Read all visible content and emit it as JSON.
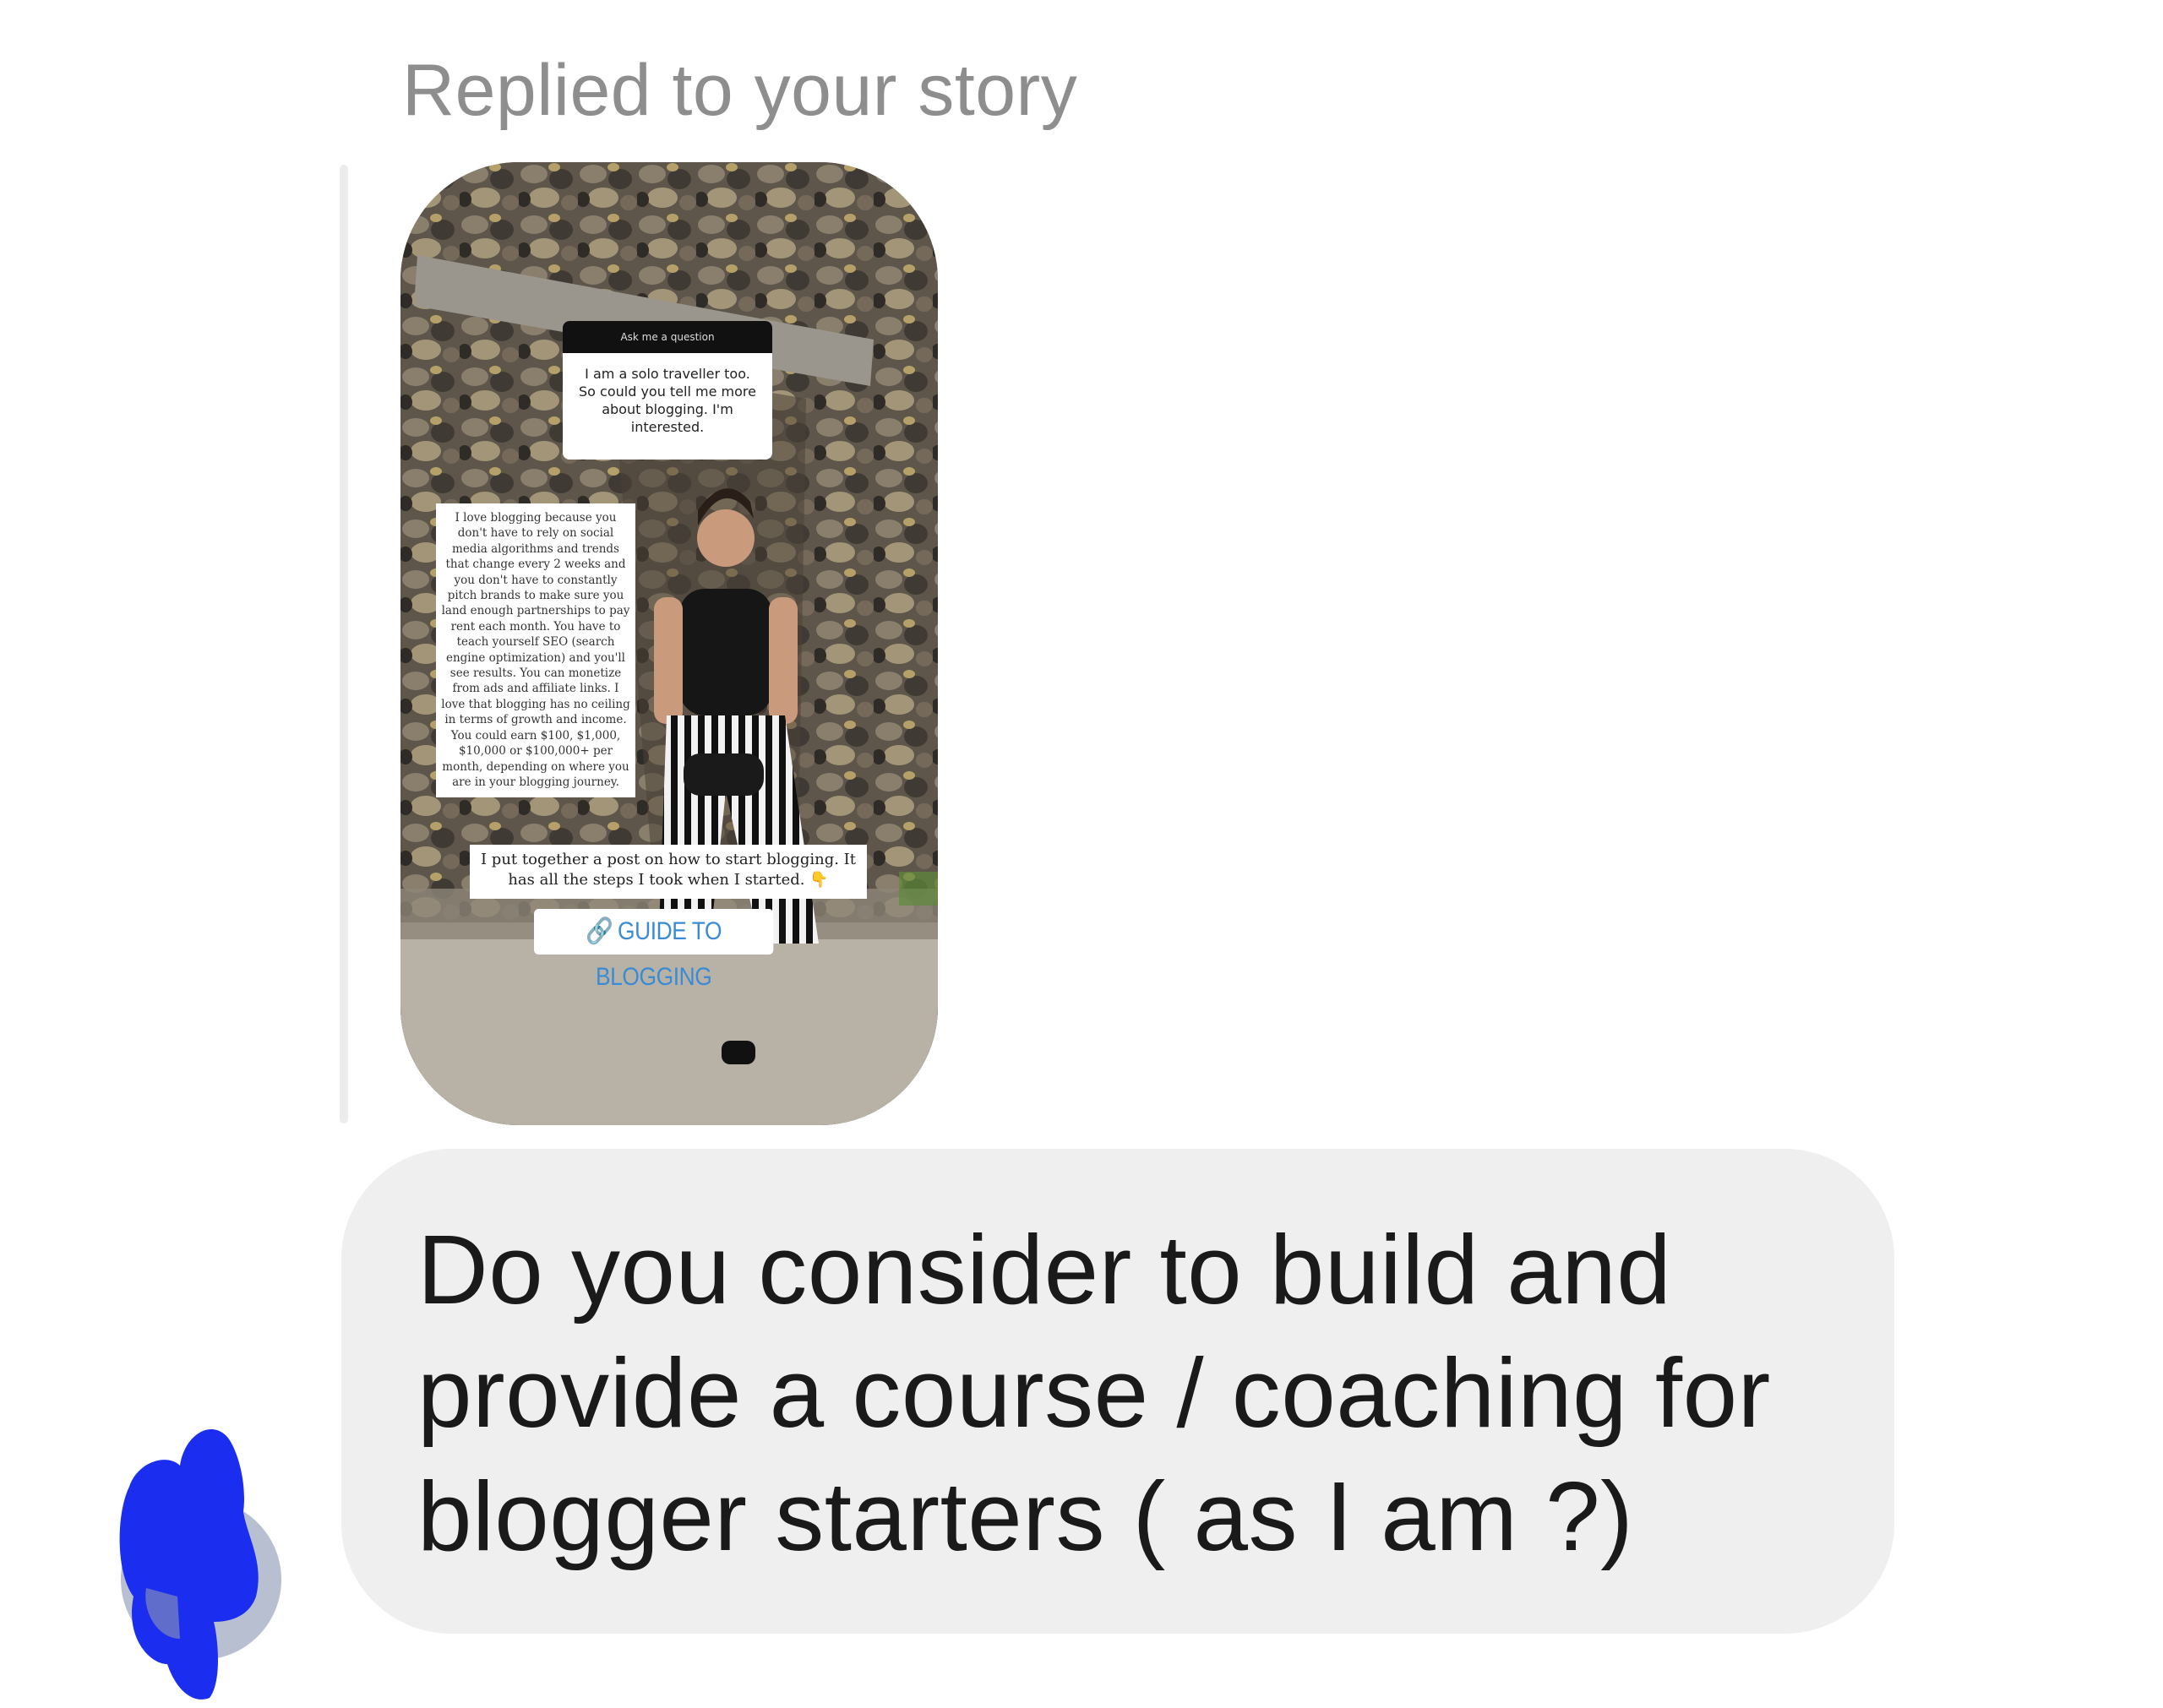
{
  "reply": {
    "header": "Replied to your story"
  },
  "story": {
    "question_box_header": "Ask me a question",
    "question_text": "I am a solo traveller too. So could you tell me more about blogging. I'm interested.",
    "answer_text": "I love blogging because you don't have to rely on social media algorithms and trends that change every 2 weeks and you don't have to constantly pitch brands to make sure you land enough partnerships to pay rent each month. You have to teach yourself SEO (search engine optimization) and you'll see results. You can monetize from ads and affiliate links. I love that blogging has no ceiling in terms of growth and income. You could earn $100, $1,000, $10,000 or $100,000+ per month, depending on where you are in your blogging journey.",
    "steps_text": "I put together a post on how to start blogging. It has all the steps I took when I started. 👇",
    "link_label": "GUIDE TO BLOGGING",
    "link_icon": "link-icon"
  },
  "message": {
    "text": "Do you consider to build and provide a course / coaching for blogger starters ( as I am ?)"
  },
  "colors": {
    "bubble_bg": "#efefef",
    "header_text": "#8e8e8e",
    "avatar_redaction": "#1b2ef0",
    "link_text": "#3a8bd6"
  }
}
